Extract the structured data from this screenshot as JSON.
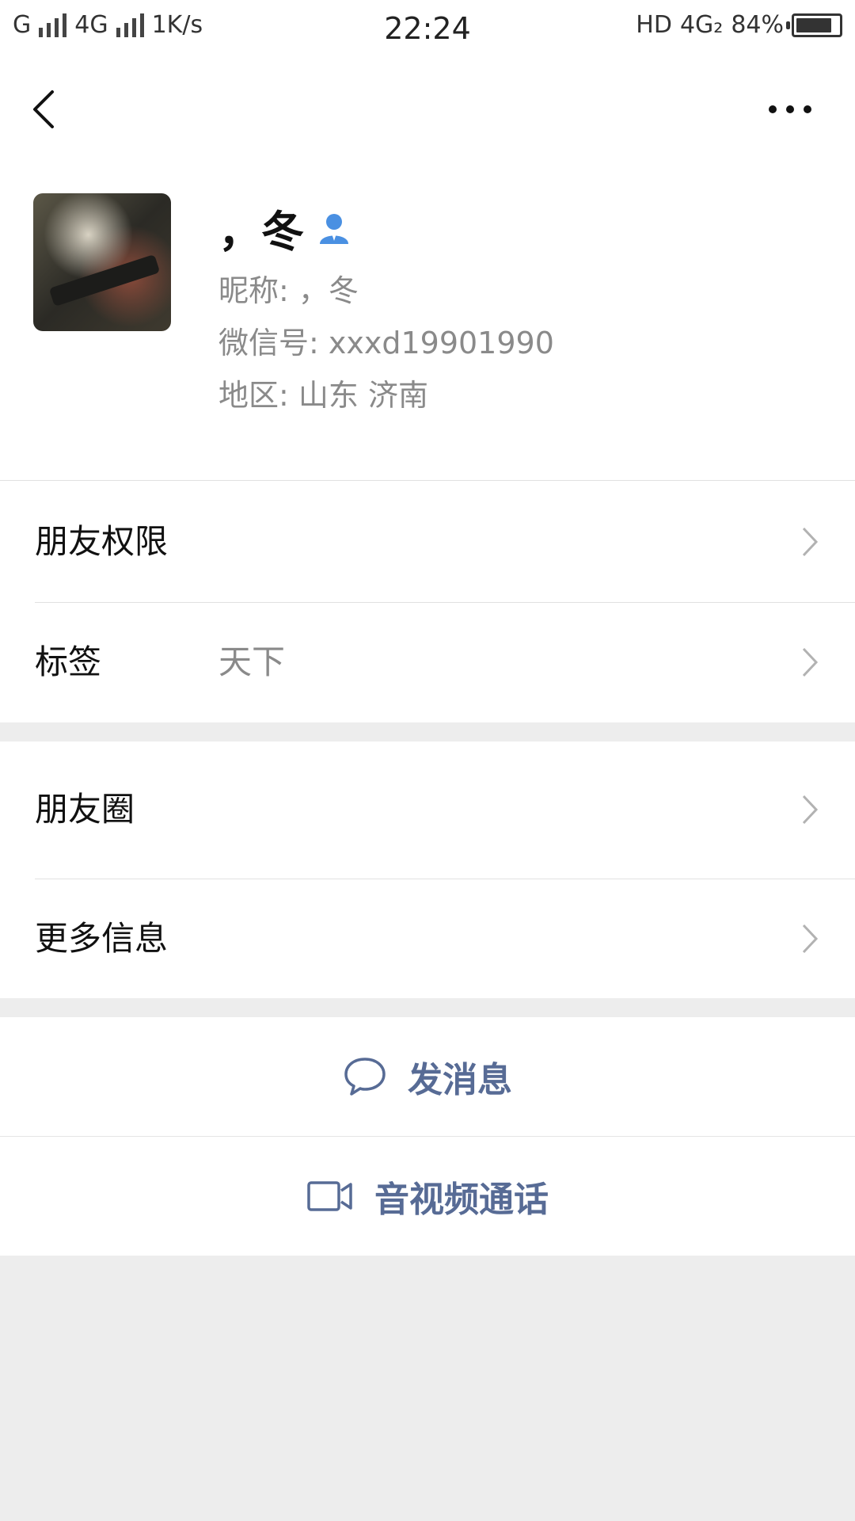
{
  "status_bar": {
    "carrier1": "G",
    "carrier2": "4G",
    "speed": "1K/s",
    "time": "22:24",
    "hd": "HD",
    "net": "4G₂",
    "battery_percent": "84%",
    "battery_level": 0.84
  },
  "profile": {
    "display_name": "，冬",
    "nickname": "昵称: ，冬",
    "wechat_id": "微信号: xxxd19901990",
    "region": "地区: 山东  济南"
  },
  "menu": {
    "friend_permission": "朋友权限",
    "tag_label": "标签",
    "tag_value": "天下",
    "moments": "朋友圈",
    "more_info": "更多信息"
  },
  "actions": {
    "send_message": "发消息",
    "call": "音视频通话"
  },
  "colors": {
    "accent": "#576b95",
    "person_icon": "#4a90e2",
    "background": "#ededed"
  }
}
